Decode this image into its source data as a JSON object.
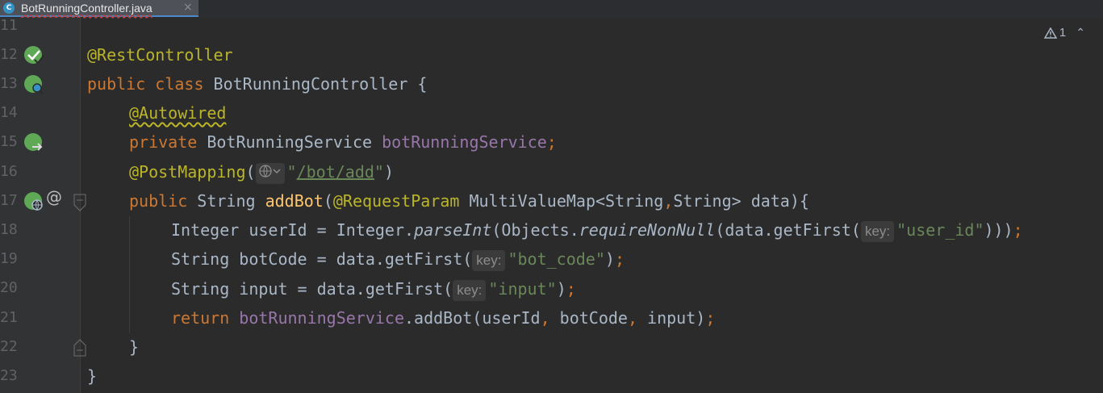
{
  "tab": {
    "filename": "BotRunningController.java",
    "icon_letter": "C",
    "close": "×"
  },
  "warnings": {
    "count": "1",
    "icon": "warning-triangle-icon",
    "chevron": "⌃"
  },
  "line_numbers": [
    "11",
    "12",
    "13",
    "14",
    "15",
    "16",
    "17",
    "18",
    "19",
    "20",
    "21",
    "22",
    "23"
  ],
  "code": {
    "l12": "@RestController",
    "l13_kw": "public class ",
    "l13_name": "BotRunningController {",
    "l14": "@Autowired",
    "l15_kw": "private ",
    "l15_type": "BotRunningService ",
    "l15_field": "botRunningService",
    "l15_semi": ";",
    "l16_ann": "@PostMapping",
    "l16_paren": "(",
    "l16_quote1": "\"",
    "l16_url": "/bot/add",
    "l16_quote2": "\"",
    "l16_close": ")",
    "l17_kw": "public ",
    "l17_type": "String ",
    "l17_method": "addBot",
    "l17_paren": "(",
    "l17_ann": "@RequestParam",
    "l17_rest": " MultiValueMap<String",
    "l17_comma": ",",
    "l17_rest2": "String> data){",
    "l18_a": "Integer userId = Integer.",
    "l18_parse": "parseInt",
    "l18_b": "(Objects.",
    "l18_req": "requireNonNull",
    "l18_c": "(data.getFirst(",
    "l18_hint": "key:",
    "l18_str": "\"user_id\"",
    "l18_d": ")))",
    "l18_semi": ";",
    "l19_a": "String botCode = data.getFirst(",
    "l19_hint": "key:",
    "l19_str": "\"bot_code\"",
    "l19_b": ")",
    "l19_semi": ";",
    "l20_a": "String input = data.getFirst(",
    "l20_hint": "key:",
    "l20_str": "\"input\"",
    "l20_b": ")",
    "l20_semi": ";",
    "l21_kw": "return ",
    "l21_field": "botRunningService",
    "l21_a": ".addBot(userId",
    "l21_c1": ", ",
    "l21_b": "botCode",
    "l21_c2": ", ",
    "l21_c": "input)",
    "l21_semi": ";",
    "l22": "}",
    "l23": "}"
  },
  "gutter_icons": {
    "l12": "spring-bean-check-icon",
    "l13": "spring-bean-search-icon",
    "l15": "spring-bean-navigate-icon",
    "l16": "globe-icon",
    "l17": "spring-web-endpoint-icon",
    "l17_at": "@"
  },
  "colors": {
    "keyword": "#cc7832",
    "annotation": "#bbb529",
    "string": "#6a8759",
    "field": "#9876aa",
    "method": "#ffc66d",
    "text": "#a9b7c6",
    "background": "#2b2b2b"
  }
}
